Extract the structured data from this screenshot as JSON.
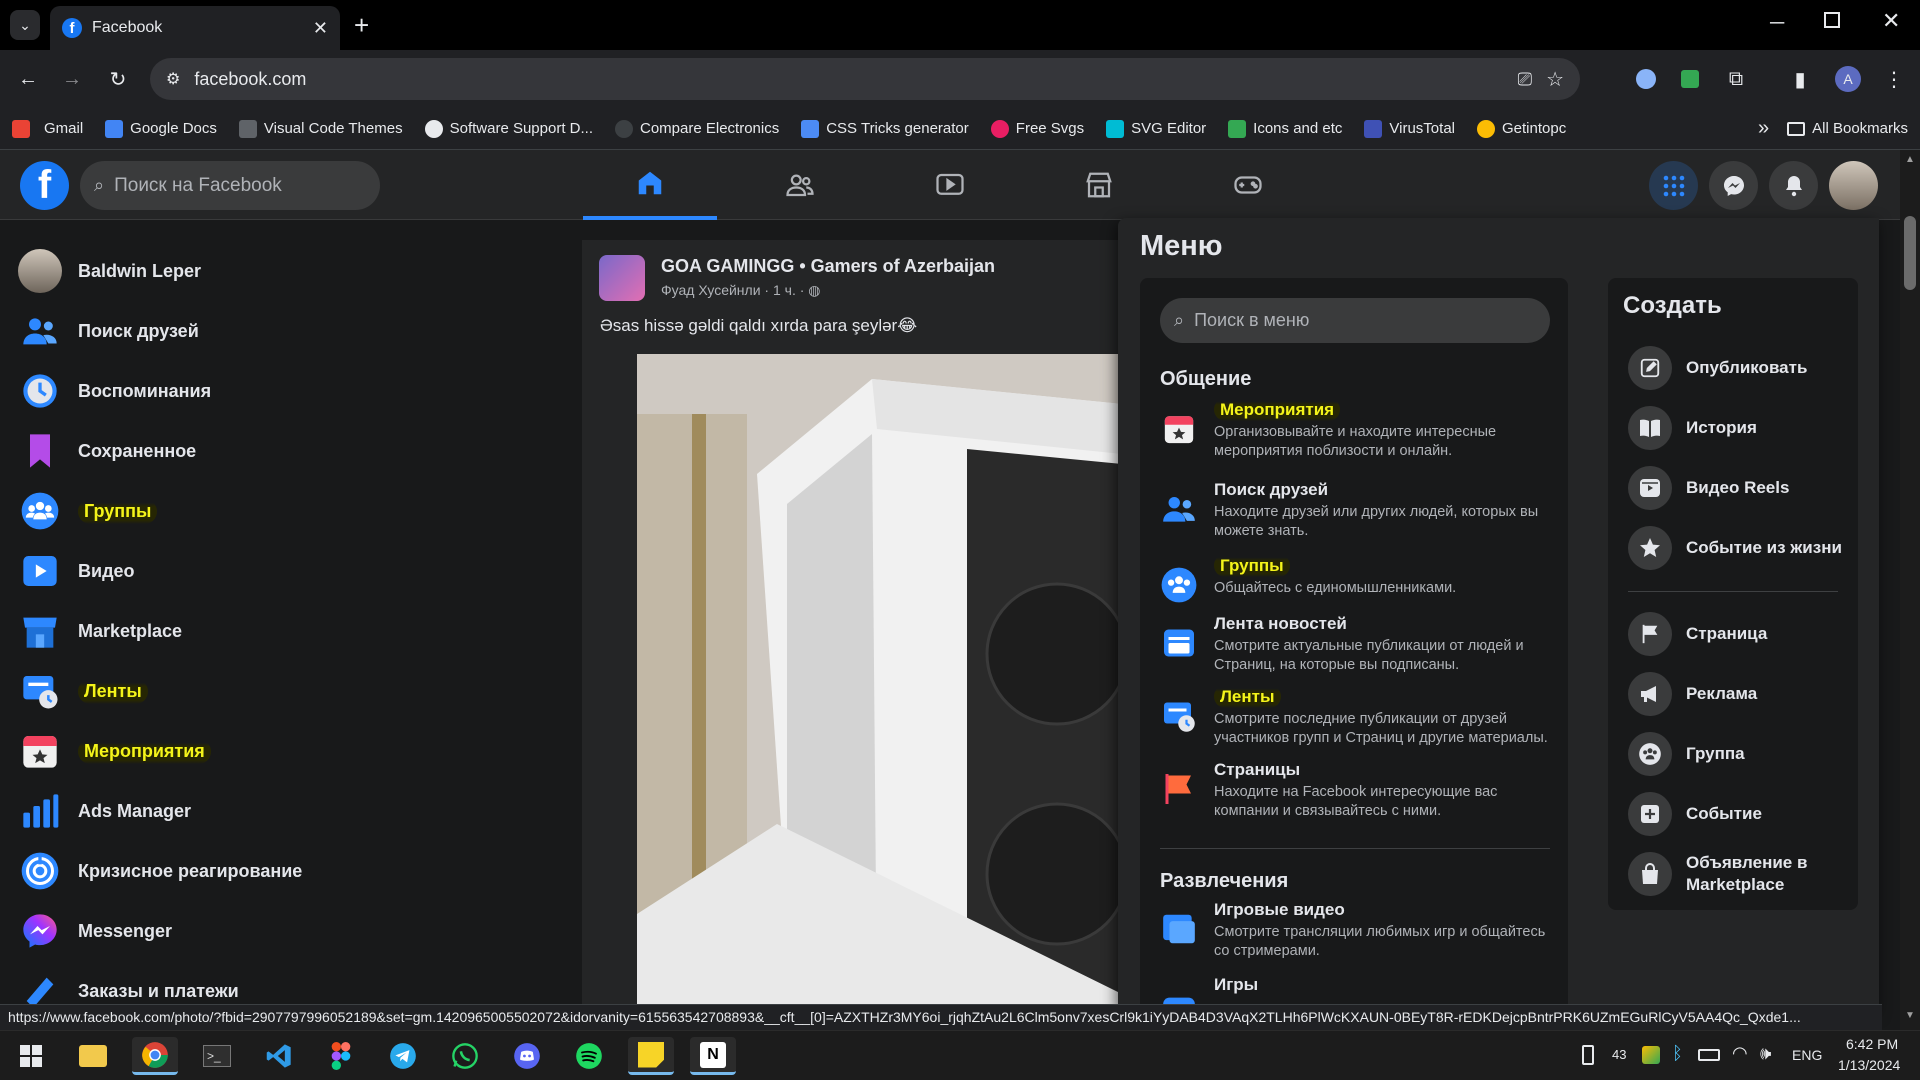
{
  "browser": {
    "tab_title": "Facebook",
    "new_tab": "+",
    "url": "facebook.com",
    "profile_initial": "A",
    "bookmarks": [
      {
        "label": "Gmail",
        "color": "#ea4335"
      },
      {
        "label": "Google Docs",
        "color": "#4285f4"
      },
      {
        "label": "Visual Code Themes",
        "color": "#e8eaed"
      },
      {
        "label": "Software Support D...",
        "color": "#e8eaed"
      },
      {
        "label": "Compare Electronics",
        "color": "#303134"
      },
      {
        "label": "CSS Tricks generator",
        "color": "#4c8bf5"
      },
      {
        "label": "Free Svgs",
        "color": "#e91e63"
      },
      {
        "label": "SVG Editor",
        "color": "#00bcd4"
      },
      {
        "label": "Icons  and etc",
        "color": "#34a853"
      },
      {
        "label": "VirusTotal",
        "color": "#3f51b5"
      },
      {
        "label": "Getintopc",
        "color": "#fbbc04"
      }
    ],
    "more": "»",
    "all_bookmarks": "All Bookmarks",
    "status_url": "https://www.facebook.com/photo/?fbid=2907797996052189&set=gm.1420965005502072&idorvanity=615563542708893&__cft__[0]=AZXTHZr3MY6oi_rjqhZtAu2L6Clm5onv7xesCrl9k1iYyDAB4D3VAqX2TLHh6PlWcKXAUN-0BEyT8R-rEDKDejcpBntrPRK6UZmEGuRlCyV5AA4Qc_Qxde1..."
  },
  "fb": {
    "search_placeholder": "Поиск на Facebook",
    "nav_tabs": [
      "home",
      "friends",
      "watch",
      "marketplace",
      "gaming"
    ],
    "sidebar": [
      {
        "label": "Baldwin Leper",
        "icon": "avatar",
        "highlight": false
      },
      {
        "label": "Поиск друзей",
        "icon": "friends-icon",
        "highlight": false
      },
      {
        "label": "Воспоминания",
        "icon": "memories-icon",
        "highlight": false
      },
      {
        "label": "Сохраненное",
        "icon": "saved-icon",
        "highlight": false
      },
      {
        "label": "Группы",
        "icon": "groups-icon",
        "highlight": true
      },
      {
        "label": "Видео",
        "icon": "video-icon",
        "highlight": false
      },
      {
        "label": "Marketplace",
        "icon": "marketplace-icon",
        "highlight": false
      },
      {
        "label": "Ленты",
        "icon": "feeds-icon",
        "highlight": true
      },
      {
        "label": "Мероприятия",
        "icon": "events-icon",
        "highlight": true
      },
      {
        "label": "Ads Manager",
        "icon": "ads-manager-icon",
        "highlight": false
      },
      {
        "label": "Кризисное реагирование",
        "icon": "crisis-response-icon",
        "highlight": false
      },
      {
        "label": "Messenger",
        "icon": "messenger-icon",
        "highlight": false
      },
      {
        "label": "Заказы и платежи",
        "icon": "orders-payments-icon",
        "highlight": false
      }
    ],
    "post": {
      "group": "GOA GAMINGG • Gamers of Azerbaijan",
      "author": "Фуад Хусейнли",
      "time": "· 1 ч. ·",
      "text": "Əsas hissə gəldi qaldı xırda para şeylər😂"
    },
    "menu": {
      "title": "Меню",
      "search_placeholder": "Поиск в меню",
      "section_social": "Общение",
      "social_items": [
        {
          "title": "Мероприятия",
          "desc": "Организовывайте и находите интересные мероприятия поблизости и онлайн.",
          "highlight": true
        },
        {
          "title": "Поиск друзей",
          "desc": "Находите друзей или других людей, которых вы можете знать.",
          "highlight": false
        },
        {
          "title": "Группы",
          "desc": "Общайтесь с единомышленниками.",
          "highlight": true
        },
        {
          "title": "Лента новостей",
          "desc": "Смотрите актуальные публикации от людей и Страниц, на которые вы подписаны.",
          "highlight": false
        },
        {
          "title": "Ленты",
          "desc": "Смотрите последние публикации от друзей участников групп и Страниц и другие материалы.",
          "highlight": true
        },
        {
          "title": "Страницы",
          "desc": "Находите на Facebook интересующие вас компании и связывайтесь с ними.",
          "highlight": false
        }
      ],
      "section_entertainment": "Развлечения",
      "entertainment_items": [
        {
          "title": "Игровые видео",
          "desc": "Смотрите трансляции любимых игр и общайтесь со стримерами."
        },
        {
          "title": "Игры",
          "desc": ""
        }
      ],
      "create_title": "Создать",
      "create_items": [
        {
          "label": "Опубликовать",
          "icon": "edit-icon"
        },
        {
          "label": "История",
          "icon": "book-icon"
        },
        {
          "label": "Видео Reels",
          "icon": "reels-icon"
        },
        {
          "label": "Событие из жизни",
          "icon": "star-icon"
        },
        {
          "label": "Страница",
          "icon": "flag-icon"
        },
        {
          "label": "Реклама",
          "icon": "megaphone-icon"
        },
        {
          "label": "Группа",
          "icon": "group-icon"
        },
        {
          "label": "Событие",
          "icon": "calendar-plus-icon"
        },
        {
          "label": "Объявление в Marketplace",
          "icon": "bag-icon"
        }
      ]
    }
  },
  "taskbar": {
    "apps": [
      "start",
      "file-explorer",
      "chrome",
      "terminal",
      "vscode",
      "figma",
      "telegram",
      "whatsapp",
      "discord",
      "spotify",
      "sticky-notes",
      "notion"
    ],
    "tray_number": "43",
    "language": "ENG",
    "time": "6:42 PM",
    "date": "1/13/2024"
  }
}
